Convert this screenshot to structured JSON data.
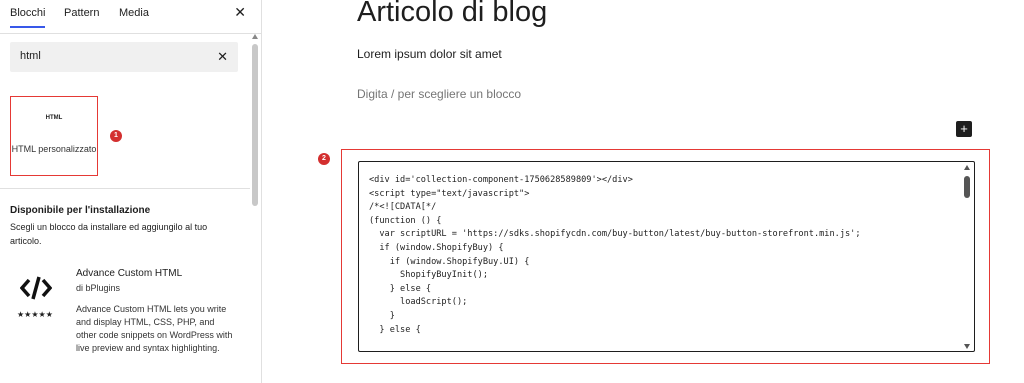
{
  "sidebar": {
    "tabs": [
      {
        "label": "Blocchi"
      },
      {
        "label": "Pattern"
      },
      {
        "label": "Media"
      }
    ],
    "close_icon": "close-icon",
    "search": {
      "value": "html",
      "clear_icon": "close-icon"
    },
    "result": {
      "icon_text": "HTML",
      "label": "HTML personalizzato",
      "marker": "1"
    },
    "install": {
      "title": "Disponibile per l'installazione",
      "description": "Scegli un blocco da installare ed aggiungilo al tuo articolo."
    },
    "plugin": {
      "name": "Advance Custom HTML",
      "author": "di bPlugins",
      "rating": "★★★★★",
      "description": "Advance Custom HTML lets you write and display HTML, CSS, PHP, and other code snippets on WordPress with live preview and syntax highlighting."
    }
  },
  "editor": {
    "title": "Articolo di blog",
    "paragraph": "Lorem ipsum dolor sit amet",
    "placeholder": "Digita / per scegliere un blocco",
    "add_block": "+",
    "html_block_marker": "2",
    "code": "<div id='collection-component-1750628589809'></div>\n<script type=\"text/javascript\">\n/*<![CDATA[*/\n(function () {\n  var scriptURL = 'https://sdks.shopifycdn.com/buy-button/latest/buy-button-storefront.min.js';\n  if (window.ShopifyBuy) {\n    if (window.ShopifyBuy.UI) {\n      ShopifyBuyInit();\n    } else {\n      loadScript();\n    }\n  } else {"
  },
  "colors": {
    "accent": "#3858e9",
    "annotation": "#e53935",
    "marker": "#d32f2f"
  }
}
